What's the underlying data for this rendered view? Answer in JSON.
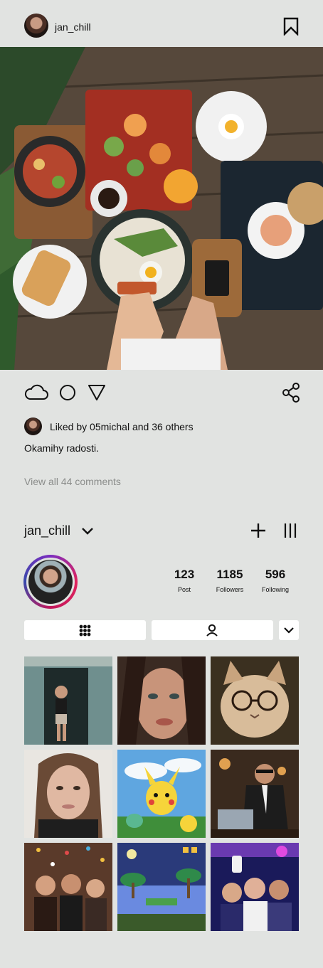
{
  "header": {
    "username": "jan_chill",
    "avatar_icon": "user-avatar",
    "bookmark_icon": "bookmark-icon"
  },
  "post": {
    "image_description_icon": "food-table-photo",
    "actions": {
      "like_icon": "cloud-icon",
      "comment_icon": "circle-icon",
      "share_icon": "send-icon",
      "network_share_icon": "share-nodes-icon"
    },
    "likes_text": "Liked by 05michal and 36 others",
    "caption": "Okamihy radosti.",
    "comments_link": "View all 44 comments"
  },
  "profile": {
    "username": "jan_chill",
    "stats": [
      {
        "value": "123",
        "label": "Post"
      },
      {
        "value": "1185",
        "label": "Followers"
      },
      {
        "value": "596",
        "label": "Following"
      }
    ],
    "tabs": {
      "grid_icon": "grid-dots-icon",
      "tagged_icon": "person-icon",
      "more_icon": "chevron-down-icon"
    },
    "grid": [
      {
        "name": "photo-woman-doorway"
      },
      {
        "name": "photo-woman-portrait"
      },
      {
        "name": "photo-cat-glasses"
      },
      {
        "name": "photo-girl-selfie"
      },
      {
        "name": "photo-pikachu"
      },
      {
        "name": "photo-man-laptop"
      },
      {
        "name": "photo-party-confetti"
      },
      {
        "name": "photo-pixel-game"
      },
      {
        "name": "photo-club-selfie"
      }
    ]
  },
  "colors": {
    "background": "#e1e3e1",
    "ring_start": "#7b2cbf",
    "ring_end": "#e0245e",
    "muted_text": "#8a8c8a"
  }
}
